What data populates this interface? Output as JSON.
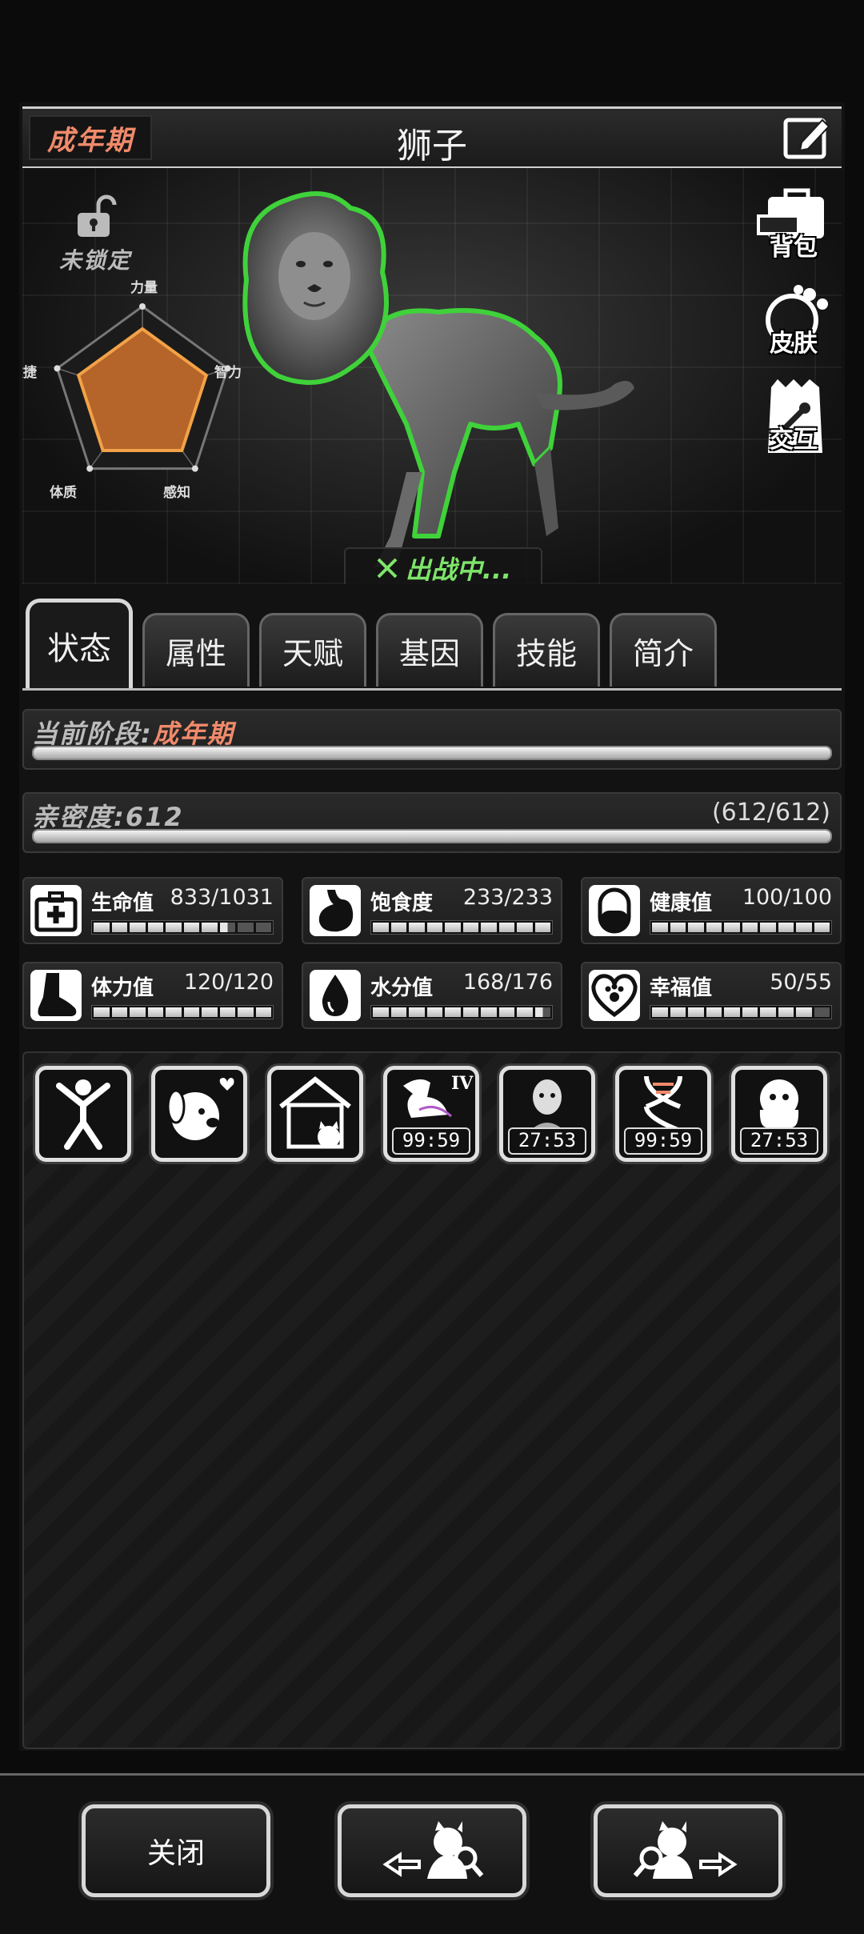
{
  "header": {
    "stage": "成年期",
    "name": "狮子"
  },
  "lock": {
    "label": "未锁定"
  },
  "radar": {
    "labels": [
      "力量",
      "智力",
      "感知",
      "体质",
      "敏捷"
    ],
    "values": [
      0.75,
      0.75,
      0.75,
      0.75,
      0.75
    ]
  },
  "battle_status": "出战中...",
  "side_buttons": [
    {
      "label": "背包",
      "icon": "backpack-icon"
    },
    {
      "label": "皮肤",
      "icon": "skin-icon"
    },
    {
      "label": "交互",
      "icon": "interact-icon"
    }
  ],
  "tabs": [
    "状态",
    "属性",
    "天赋",
    "基因",
    "技能",
    "简介"
  ],
  "stage_bar": {
    "label": "当前阶段:",
    "value": "成年期",
    "progress": 1.0
  },
  "intimacy": {
    "label": "亲密度:",
    "value": "612",
    "fraction": "(612/612)",
    "progress": 1.0
  },
  "stats": [
    {
      "name": "生命值",
      "value": "833/1031",
      "icon": "medkit-icon",
      "filled": 7.5
    },
    {
      "name": "饱食度",
      "value": "233/233",
      "icon": "stomach-icon",
      "filled": 10
    },
    {
      "name": "健康值",
      "value": "100/100",
      "icon": "pill-icon",
      "filled": 10
    },
    {
      "name": "体力值",
      "value": "120/120",
      "icon": "foot-icon",
      "filled": 10
    },
    {
      "name": "水分值",
      "value": "168/176",
      "icon": "water-drop-icon",
      "filled": 9.5
    },
    {
      "name": "幸福值",
      "value": "50/55",
      "icon": "heart-paw-icon",
      "filled": 9
    }
  ],
  "buffs": [
    {
      "icon": "person-stretch-icon",
      "timer": ""
    },
    {
      "icon": "dog-love-icon",
      "timer": ""
    },
    {
      "icon": "pet-house-icon",
      "timer": ""
    },
    {
      "icon": "flexed-arm-iv-icon",
      "timer": "99:59",
      "level": "IV"
    },
    {
      "icon": "old-man-icon",
      "timer": "27:53"
    },
    {
      "icon": "dna-icon",
      "timer": "99:59"
    },
    {
      "icon": "ghost-icon",
      "timer": "27:53"
    }
  ],
  "footer": {
    "close_label": "关闭"
  },
  "colors": {
    "accent": "#f08a6b",
    "battle": "#7ee56a",
    "radar_fill": "#b5642a"
  }
}
